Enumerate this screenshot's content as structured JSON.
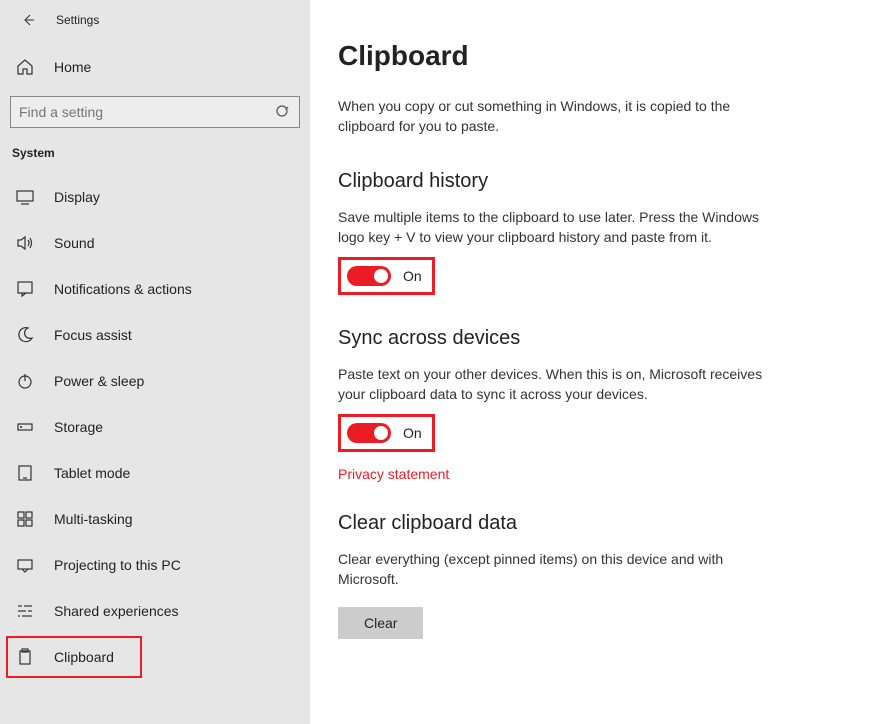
{
  "app_title": "Settings",
  "home_label": "Home",
  "search": {
    "placeholder": "Find a setting"
  },
  "section_label": "System",
  "nav": [
    {
      "label": "Display"
    },
    {
      "label": "Sound"
    },
    {
      "label": "Notifications & actions"
    },
    {
      "label": "Focus assist"
    },
    {
      "label": "Power & sleep"
    },
    {
      "label": "Storage"
    },
    {
      "label": "Tablet mode"
    },
    {
      "label": "Multi-tasking"
    },
    {
      "label": "Projecting to this PC"
    },
    {
      "label": "Shared experiences"
    },
    {
      "label": "Clipboard"
    }
  ],
  "main": {
    "title": "Clipboard",
    "desc": "When you copy or cut something in Windows, it is copied to the clipboard for you to paste.",
    "history": {
      "title": "Clipboard history",
      "desc": "Save multiple items to the clipboard to use later. Press the Windows logo key + V to view your clipboard history and paste from it.",
      "toggle_label": "On"
    },
    "sync": {
      "title": "Sync across devices",
      "desc": "Paste text on your other devices. When this is on, Microsoft receives your clipboard data to sync it across your devices.",
      "toggle_label": "On",
      "privacy_link": "Privacy statement"
    },
    "clear": {
      "title": "Clear clipboard data",
      "desc": "Clear everything (except pinned items) on this device and with Microsoft.",
      "button": "Clear"
    }
  }
}
